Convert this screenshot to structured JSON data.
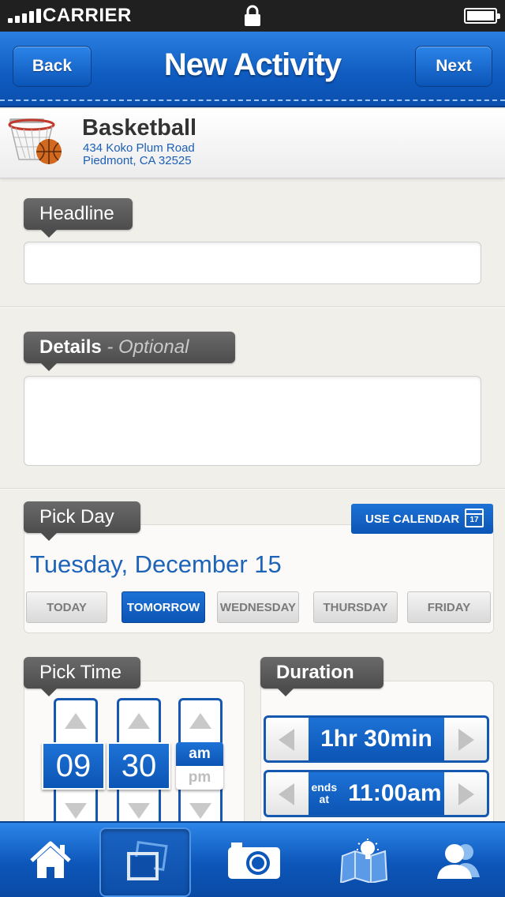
{
  "status_bar": {
    "carrier": "CARRIER"
  },
  "nav": {
    "back_label": "Back",
    "title": "New Activity",
    "next_label": "Next"
  },
  "activity": {
    "name": "Basketball",
    "address_line1": "434 Koko Plum Road",
    "address_line2": "Piedmont, CA 32525",
    "icon": "basketball-hoop-icon"
  },
  "headline": {
    "label": "Headline",
    "value": ""
  },
  "details": {
    "label": "Details",
    "optional_label": "- Optional",
    "value": ""
  },
  "pick_day": {
    "label": "Pick Day",
    "calendar_button": "USE CALENDAR",
    "calendar_day": "17",
    "selected_date": "Tuesday, December 15",
    "days": [
      "TODAY",
      "TOMORROW",
      "WEDNESDAY",
      "THURSDAY",
      "FRIDAY"
    ],
    "selected_index": 1
  },
  "pick_time": {
    "label": "Pick Time",
    "hour": "09",
    "minute": "30",
    "am": "am",
    "pm": "pm",
    "selected_period": "am"
  },
  "duration": {
    "label": "Duration",
    "value": "1hr 30min",
    "ends_label": "ends at",
    "ends_word1": "ends",
    "ends_word2": "at",
    "ends_time": "11:00am"
  },
  "tab_bar": {
    "items": [
      "home-icon",
      "gallery-icon",
      "camera-icon",
      "map-idea-icon",
      "people-icon"
    ],
    "active_index": 1
  },
  "colors": {
    "brand_blue": "#0b55b5",
    "label_gray": "#4d4d4d",
    "link_blue": "#1d64b8"
  }
}
